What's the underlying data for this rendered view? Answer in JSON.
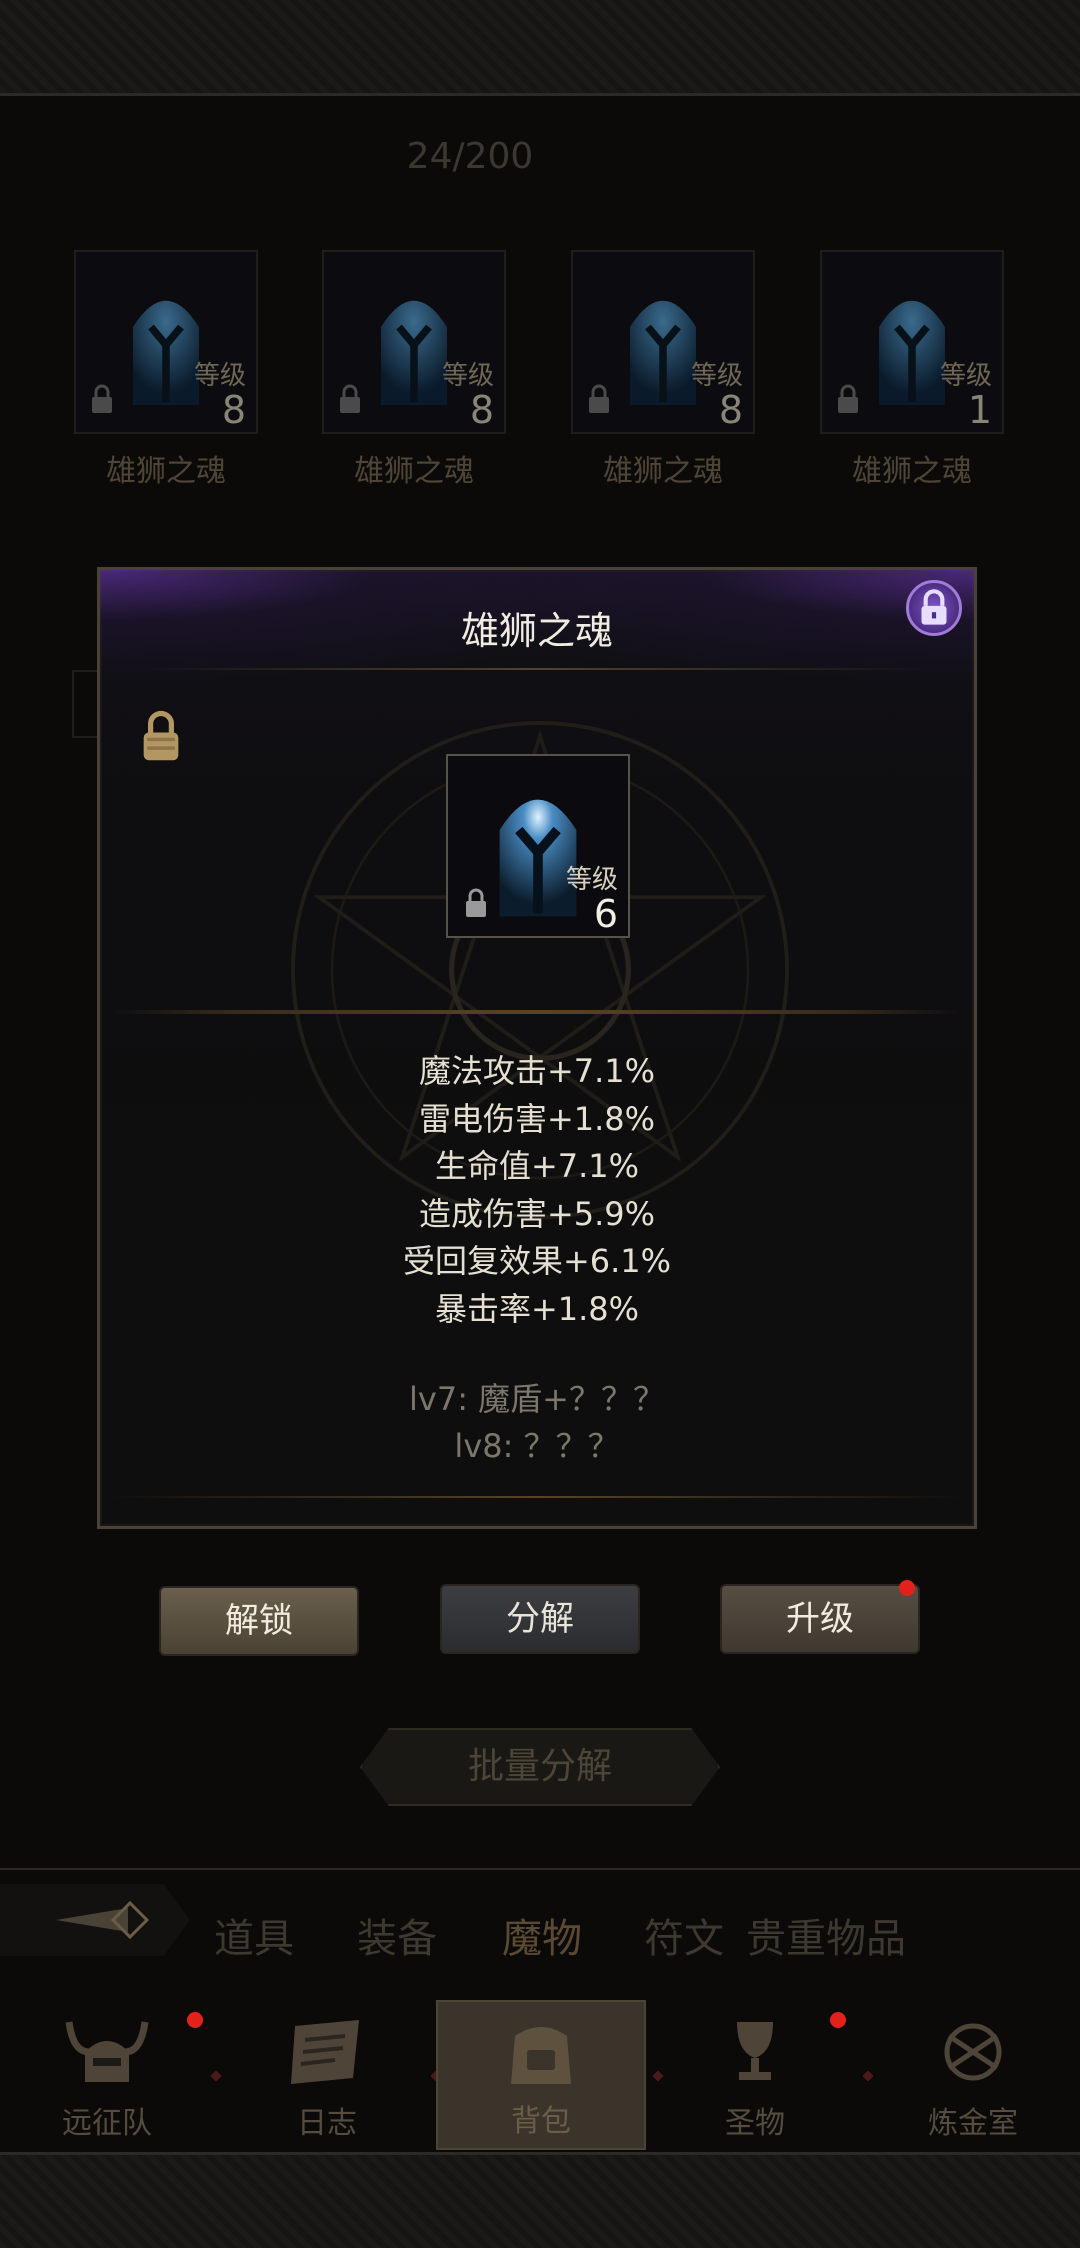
{
  "header": {
    "counter": "24/200"
  },
  "inventory": {
    "items": [
      {
        "name": "雄狮之魂",
        "level_label": "等级",
        "level": "8",
        "locked": true
      },
      {
        "name": "雄狮之魂",
        "level_label": "等级",
        "level": "8",
        "locked": true
      },
      {
        "name": "雄狮之魂",
        "level_label": "等级",
        "level": "8",
        "locked": true
      },
      {
        "name": "雄狮之魂",
        "level_label": "等级",
        "level": "1",
        "locked": true
      }
    ]
  },
  "dialog": {
    "title": "雄狮之魂",
    "item": {
      "level_label": "等级",
      "level": "6"
    },
    "stats": [
      "魔法攻击+7.1%",
      "雷电伤害+1.8%",
      "生命值+7.1%",
      "造成伤害+5.9%",
      "受回复效果+6.1%",
      "暴击率+1.8%"
    ],
    "locked_stats": [
      "lv7: 魔盾+？？？",
      "lv8: ？？？"
    ],
    "buttons": {
      "unlock": "解锁",
      "decompose": "分解",
      "upgrade": "升级"
    }
  },
  "batch_decompose": "批量分解",
  "tabs": [
    "道具",
    "装备",
    "魔物",
    "符文",
    "贵重物品"
  ],
  "active_tab": "魔物",
  "nav": [
    {
      "label": "远征队",
      "icon": "viking-helmet-icon",
      "badge": true
    },
    {
      "label": "日志",
      "icon": "scroll-icon",
      "badge": false
    },
    {
      "label": "背包",
      "icon": "backpack-icon",
      "badge": false
    },
    {
      "label": "圣物",
      "icon": "chalice-icon",
      "badge": true
    },
    {
      "label": "炼金室",
      "icon": "alchemy-icon",
      "badge": false
    }
  ],
  "colors": {
    "accent_purple": "#7f56c6",
    "badge_red": "#e2221a",
    "gold": "#b89a5a"
  }
}
